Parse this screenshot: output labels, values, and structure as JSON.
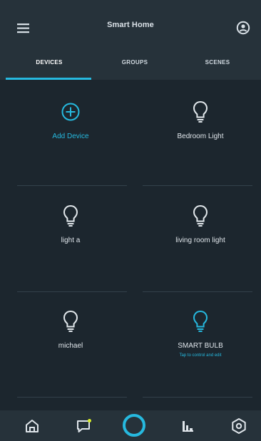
{
  "app": {
    "title": "Smart Home"
  },
  "tabs": [
    {
      "label": "DEVICES",
      "active": true
    },
    {
      "label": "GROUPS",
      "active": false
    },
    {
      "label": "SCENES",
      "active": false
    }
  ],
  "devices": [
    {
      "label": "Add Device",
      "icon": "plus-circle-icon",
      "accent": true
    },
    {
      "label": "Bedroom Light",
      "icon": "light-bulb-icon",
      "accent": false
    },
    {
      "label": "light a",
      "icon": "light-bulb-icon",
      "accent": false
    },
    {
      "label": "living room light",
      "icon": "light-bulb-icon",
      "accent": false
    },
    {
      "label": "michael",
      "icon": "light-bulb-icon",
      "accent": false
    },
    {
      "label": "SMART BULB",
      "subtitle": "Tap to control and edit",
      "icon": "light-bulb-icon",
      "accent": true
    }
  ],
  "bottom_nav": [
    {
      "icon": "home-icon"
    },
    {
      "icon": "chat-icon"
    },
    {
      "icon": "alexa-icon"
    },
    {
      "icon": "activity-icon"
    },
    {
      "icon": "gear-icon"
    }
  ],
  "colors": {
    "background": "#1c262e",
    "header": "#26323a",
    "accent": "#26b9df",
    "text": "#dfe5ea",
    "divider": "#33414b",
    "notification": "#d9ef2a"
  }
}
